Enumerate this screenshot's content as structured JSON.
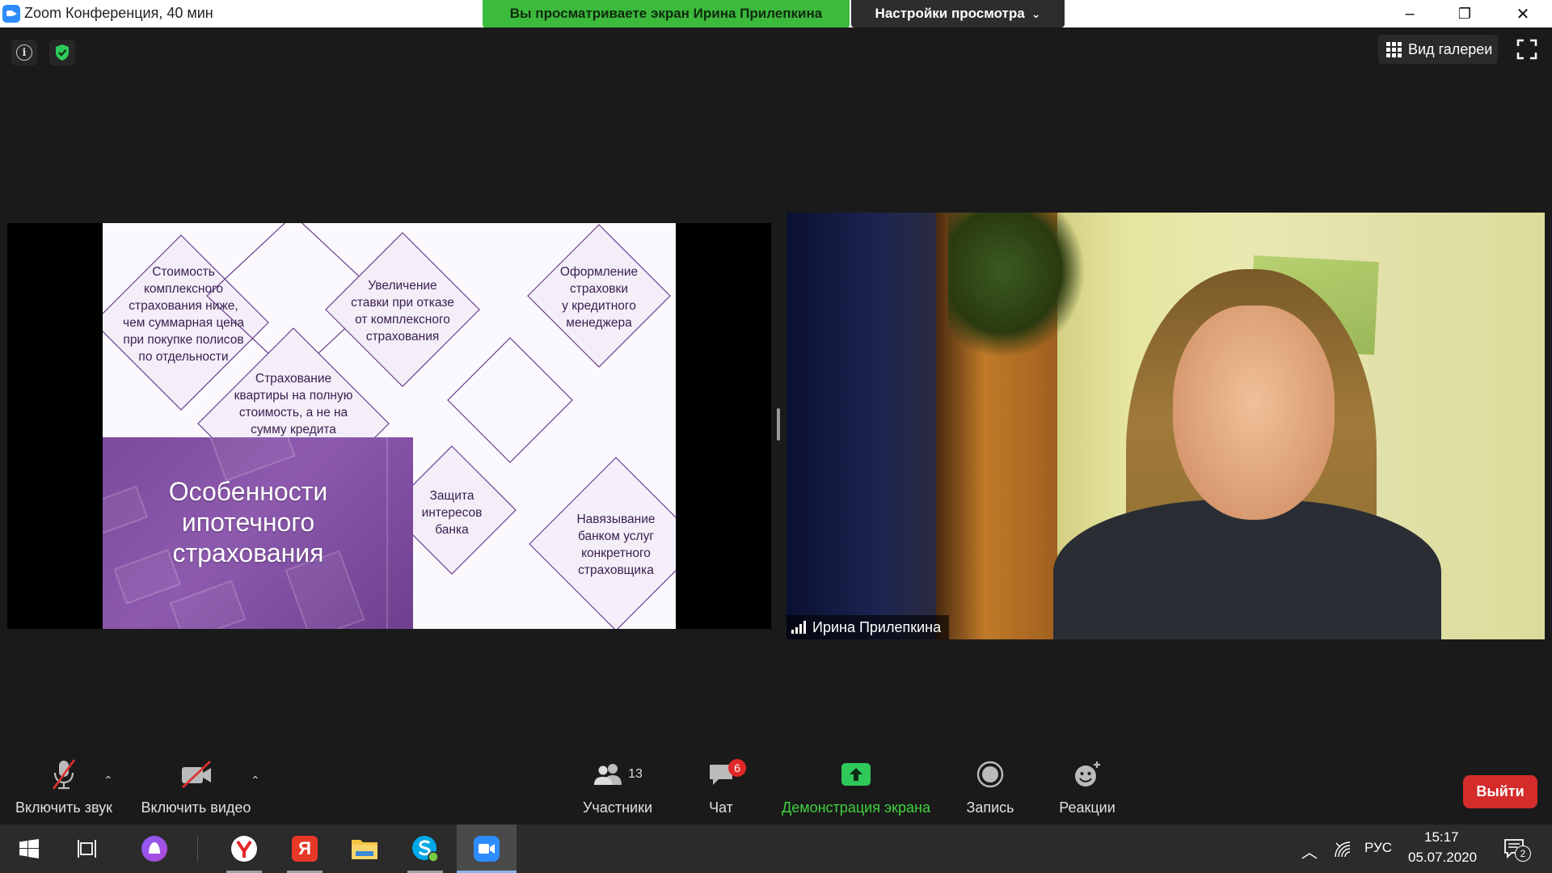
{
  "window": {
    "title": "Zoom Конференция, 40 мин",
    "share_banner": "Вы просматриваете экран Ирина Прилепкина",
    "view_options": "Настройки просмотра",
    "view_options_caret": "⌄",
    "minimize": "–",
    "maximize": "❐",
    "close": "✕"
  },
  "top_controls": {
    "info_glyph": "i",
    "gallery_view_label": "Вид галереи"
  },
  "slide": {
    "title": "Особенности\nипотечного\nстрахования",
    "diamonds": [
      {
        "text": "Стоимость\nкомплексного\nстрахования ниже,\nчем суммарная цена\nпри покупке полисов\nпо отдельности"
      },
      {
        "text": "Увеличение\nставки при отказе\nот комплексного\nстрахования"
      },
      {
        "text": "Оформление\nстраховки\nу кредитного\nменеджера"
      },
      {
        "text": "Страхование\nквартиры на полную\nстоимость, а не на\nсумму кредита"
      },
      {
        "text": "Защита\nинтересов\nбанка"
      },
      {
        "text": "Навязывание\nбанком услуг\nконкретного\nстраховщика"
      }
    ]
  },
  "participant": {
    "name": "Ирина Прилепкина"
  },
  "toolbar": {
    "unmute_label": "Включить звук",
    "start_video_label": "Включить видео",
    "caret": "⌃",
    "participants_label": "Участники",
    "participants_count": "13",
    "chat_label": "Чат",
    "chat_badge": "6",
    "share_label": "Демонстрация экрана",
    "record_label": "Запись",
    "reactions_label": "Реакции",
    "leave_label": "Выйти"
  },
  "taskbar": {
    "language": "РУС",
    "time": "15:17",
    "date": "05.07.2020",
    "notifications_count": "2",
    "yandex_letter": "Я",
    "tray_up": "︿"
  },
  "colors": {
    "share_banner": "#3cba3c",
    "share_label": "#3fd23f",
    "leave": "#d42b2b",
    "slide_accent": "#6a3f8c"
  }
}
